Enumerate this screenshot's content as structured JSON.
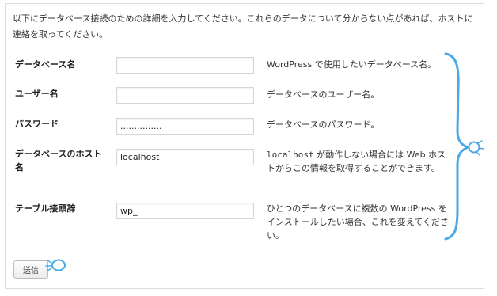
{
  "intro": "以下にデータベース接続のための詳細を入力してください。これらのデータについて分からない点があれば、ホストに連絡を取ってください。",
  "fields": {
    "dbname": {
      "label": "データベース名",
      "value": "",
      "description": "WordPress で使用したいデータベース名。"
    },
    "uname": {
      "label": "ユーザー名",
      "value": "",
      "description": "データベースのユーザー名。"
    },
    "pwd": {
      "label": "パスワード",
      "value": "...............",
      "description": "データベースのパスワード。"
    },
    "dbhost": {
      "label": "データベースのホスト名",
      "value": "localhost",
      "description_code": "localhost",
      "description_rest": " が動作しない場合には Web ホストからこの情報を取得することができます。"
    },
    "prefix": {
      "label": "テーブル接頭辞",
      "value": "wp_",
      "description": "ひとつのデータベースに複数の WordPress をインストールしたい場合、これを変えてください。"
    }
  },
  "submit_label": "送信",
  "annotation_color": "#4aa8e8"
}
